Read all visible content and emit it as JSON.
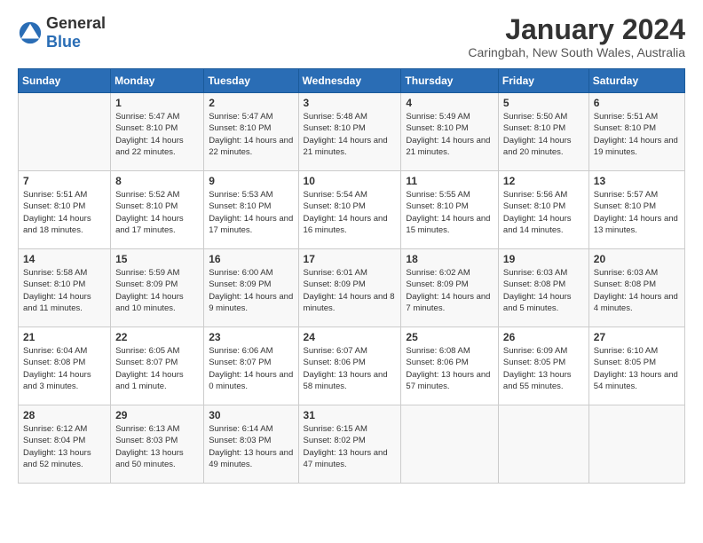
{
  "logo": {
    "text_general": "General",
    "text_blue": "Blue"
  },
  "title": "January 2024",
  "subtitle": "Caringbah, New South Wales, Australia",
  "days_of_week": [
    "Sunday",
    "Monday",
    "Tuesday",
    "Wednesday",
    "Thursday",
    "Friday",
    "Saturday"
  ],
  "weeks": [
    [
      {
        "day": "",
        "sunrise": "",
        "sunset": "",
        "daylight": ""
      },
      {
        "day": "1",
        "sunrise": "Sunrise: 5:47 AM",
        "sunset": "Sunset: 8:10 PM",
        "daylight": "Daylight: 14 hours and 22 minutes."
      },
      {
        "day": "2",
        "sunrise": "Sunrise: 5:47 AM",
        "sunset": "Sunset: 8:10 PM",
        "daylight": "Daylight: 14 hours and 22 minutes."
      },
      {
        "day": "3",
        "sunrise": "Sunrise: 5:48 AM",
        "sunset": "Sunset: 8:10 PM",
        "daylight": "Daylight: 14 hours and 21 minutes."
      },
      {
        "day": "4",
        "sunrise": "Sunrise: 5:49 AM",
        "sunset": "Sunset: 8:10 PM",
        "daylight": "Daylight: 14 hours and 21 minutes."
      },
      {
        "day": "5",
        "sunrise": "Sunrise: 5:50 AM",
        "sunset": "Sunset: 8:10 PM",
        "daylight": "Daylight: 14 hours and 20 minutes."
      },
      {
        "day": "6",
        "sunrise": "Sunrise: 5:51 AM",
        "sunset": "Sunset: 8:10 PM",
        "daylight": "Daylight: 14 hours and 19 minutes."
      }
    ],
    [
      {
        "day": "7",
        "sunrise": "Sunrise: 5:51 AM",
        "sunset": "Sunset: 8:10 PM",
        "daylight": "Daylight: 14 hours and 18 minutes."
      },
      {
        "day": "8",
        "sunrise": "Sunrise: 5:52 AM",
        "sunset": "Sunset: 8:10 PM",
        "daylight": "Daylight: 14 hours and 17 minutes."
      },
      {
        "day": "9",
        "sunrise": "Sunrise: 5:53 AM",
        "sunset": "Sunset: 8:10 PM",
        "daylight": "Daylight: 14 hours and 17 minutes."
      },
      {
        "day": "10",
        "sunrise": "Sunrise: 5:54 AM",
        "sunset": "Sunset: 8:10 PM",
        "daylight": "Daylight: 14 hours and 16 minutes."
      },
      {
        "day": "11",
        "sunrise": "Sunrise: 5:55 AM",
        "sunset": "Sunset: 8:10 PM",
        "daylight": "Daylight: 14 hours and 15 minutes."
      },
      {
        "day": "12",
        "sunrise": "Sunrise: 5:56 AM",
        "sunset": "Sunset: 8:10 PM",
        "daylight": "Daylight: 14 hours and 14 minutes."
      },
      {
        "day": "13",
        "sunrise": "Sunrise: 5:57 AM",
        "sunset": "Sunset: 8:10 PM",
        "daylight": "Daylight: 14 hours and 13 minutes."
      }
    ],
    [
      {
        "day": "14",
        "sunrise": "Sunrise: 5:58 AM",
        "sunset": "Sunset: 8:10 PM",
        "daylight": "Daylight: 14 hours and 11 minutes."
      },
      {
        "day": "15",
        "sunrise": "Sunrise: 5:59 AM",
        "sunset": "Sunset: 8:09 PM",
        "daylight": "Daylight: 14 hours and 10 minutes."
      },
      {
        "day": "16",
        "sunrise": "Sunrise: 6:00 AM",
        "sunset": "Sunset: 8:09 PM",
        "daylight": "Daylight: 14 hours and 9 minutes."
      },
      {
        "day": "17",
        "sunrise": "Sunrise: 6:01 AM",
        "sunset": "Sunset: 8:09 PM",
        "daylight": "Daylight: 14 hours and 8 minutes."
      },
      {
        "day": "18",
        "sunrise": "Sunrise: 6:02 AM",
        "sunset": "Sunset: 8:09 PM",
        "daylight": "Daylight: 14 hours and 7 minutes."
      },
      {
        "day": "19",
        "sunrise": "Sunrise: 6:03 AM",
        "sunset": "Sunset: 8:08 PM",
        "daylight": "Daylight: 14 hours and 5 minutes."
      },
      {
        "day": "20",
        "sunrise": "Sunrise: 6:03 AM",
        "sunset": "Sunset: 8:08 PM",
        "daylight": "Daylight: 14 hours and 4 minutes."
      }
    ],
    [
      {
        "day": "21",
        "sunrise": "Sunrise: 6:04 AM",
        "sunset": "Sunset: 8:08 PM",
        "daylight": "Daylight: 14 hours and 3 minutes."
      },
      {
        "day": "22",
        "sunrise": "Sunrise: 6:05 AM",
        "sunset": "Sunset: 8:07 PM",
        "daylight": "Daylight: 14 hours and 1 minute."
      },
      {
        "day": "23",
        "sunrise": "Sunrise: 6:06 AM",
        "sunset": "Sunset: 8:07 PM",
        "daylight": "Daylight: 14 hours and 0 minutes."
      },
      {
        "day": "24",
        "sunrise": "Sunrise: 6:07 AM",
        "sunset": "Sunset: 8:06 PM",
        "daylight": "Daylight: 13 hours and 58 minutes."
      },
      {
        "day": "25",
        "sunrise": "Sunrise: 6:08 AM",
        "sunset": "Sunset: 8:06 PM",
        "daylight": "Daylight: 13 hours and 57 minutes."
      },
      {
        "day": "26",
        "sunrise": "Sunrise: 6:09 AM",
        "sunset": "Sunset: 8:05 PM",
        "daylight": "Daylight: 13 hours and 55 minutes."
      },
      {
        "day": "27",
        "sunrise": "Sunrise: 6:10 AM",
        "sunset": "Sunset: 8:05 PM",
        "daylight": "Daylight: 13 hours and 54 minutes."
      }
    ],
    [
      {
        "day": "28",
        "sunrise": "Sunrise: 6:12 AM",
        "sunset": "Sunset: 8:04 PM",
        "daylight": "Daylight: 13 hours and 52 minutes."
      },
      {
        "day": "29",
        "sunrise": "Sunrise: 6:13 AM",
        "sunset": "Sunset: 8:03 PM",
        "daylight": "Daylight: 13 hours and 50 minutes."
      },
      {
        "day": "30",
        "sunrise": "Sunrise: 6:14 AM",
        "sunset": "Sunset: 8:03 PM",
        "daylight": "Daylight: 13 hours and 49 minutes."
      },
      {
        "day": "31",
        "sunrise": "Sunrise: 6:15 AM",
        "sunset": "Sunset: 8:02 PM",
        "daylight": "Daylight: 13 hours and 47 minutes."
      },
      {
        "day": "",
        "sunrise": "",
        "sunset": "",
        "daylight": ""
      },
      {
        "day": "",
        "sunrise": "",
        "sunset": "",
        "daylight": ""
      },
      {
        "day": "",
        "sunrise": "",
        "sunset": "",
        "daylight": ""
      }
    ]
  ]
}
